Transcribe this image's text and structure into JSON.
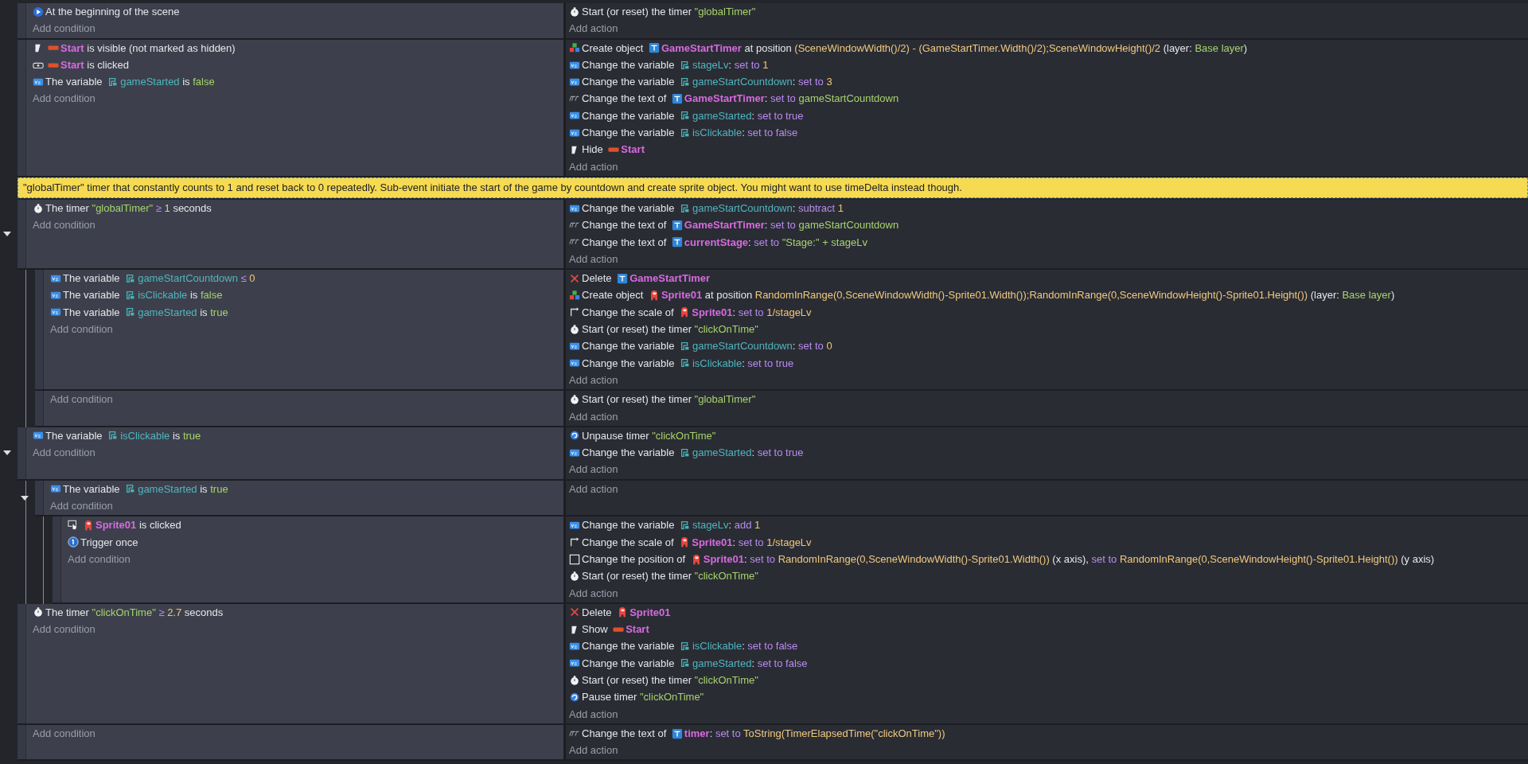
{
  "events": [
    {
      "kind": "event",
      "conditions": [
        {
          "kind": "scene-start",
          "parts": [
            {
              "kind": "plain",
              "text": "At the beginning of the scene"
            }
          ]
        }
      ],
      "add_condition": "Add condition",
      "actions": [
        {
          "kind": "timer",
          "parts": [
            {
              "kind": "plain",
              "text": "Start (or reset) the timer "
            },
            {
              "kind": "str",
              "text": "\"globalTimer\""
            }
          ]
        }
      ],
      "add_action": "Add action"
    },
    {
      "kind": "event",
      "conditions": [
        {
          "kind": "visible",
          "parts": [
            {
              "kind": "obj-button",
              "text": "Start"
            },
            {
              "kind": "plain",
              "text": " is visible (not marked as hidden)"
            }
          ]
        },
        {
          "kind": "click",
          "parts": [
            {
              "kind": "obj-button",
              "text": "Start"
            },
            {
              "kind": "plain",
              "text": " is clicked"
            }
          ]
        },
        {
          "kind": "var",
          "parts": [
            {
              "kind": "plain",
              "text": "The variable "
            },
            {
              "kind": "var",
              "text": "gameStarted"
            },
            {
              "kind": "plain",
              "text": " is "
            },
            {
              "kind": "val",
              "text": "false"
            }
          ]
        }
      ],
      "add_condition": "Add condition",
      "actions": [
        {
          "kind": "create",
          "parts": [
            {
              "kind": "plain",
              "text": "Create object "
            },
            {
              "kind": "obj-text",
              "text": "GameStartTimer"
            },
            {
              "kind": "plain",
              "text": " at position "
            },
            {
              "kind": "expr",
              "text": "(SceneWindowWidth()/2) - (GameStartTimer.Width()/2);SceneWindowHeight()/2"
            },
            {
              "kind": "plain",
              "text": " (layer: "
            },
            {
              "kind": "val",
              "text": "Base layer"
            },
            {
              "kind": "plain",
              "text": ")"
            }
          ]
        },
        {
          "kind": "var",
          "parts": [
            {
              "kind": "plain",
              "text": "Change the variable "
            },
            {
              "kind": "var",
              "text": "stageLv"
            },
            {
              "kind": "plain",
              "text": ": "
            },
            {
              "kind": "op",
              "text": "set to "
            },
            {
              "kind": "num",
              "text": "1"
            }
          ]
        },
        {
          "kind": "var",
          "parts": [
            {
              "kind": "plain",
              "text": "Change the variable "
            },
            {
              "kind": "var",
              "text": "gameStartCountdown"
            },
            {
              "kind": "plain",
              "text": ": "
            },
            {
              "kind": "op",
              "text": "set to "
            },
            {
              "kind": "num",
              "text": "3"
            }
          ]
        },
        {
          "kind": "text",
          "parts": [
            {
              "kind": "plain",
              "text": "Change the text of "
            },
            {
              "kind": "obj-text",
              "text": "GameStartTimer"
            },
            {
              "kind": "plain",
              "text": ": "
            },
            {
              "kind": "op",
              "text": "set to "
            },
            {
              "kind": "val",
              "text": "gameStartCountdown"
            }
          ]
        },
        {
          "kind": "var",
          "parts": [
            {
              "kind": "plain",
              "text": "Change the variable "
            },
            {
              "kind": "var",
              "text": "gameStarted"
            },
            {
              "kind": "plain",
              "text": ": "
            },
            {
              "kind": "op",
              "text": "set to true"
            }
          ]
        },
        {
          "kind": "var",
          "parts": [
            {
              "kind": "plain",
              "text": "Change the variable "
            },
            {
              "kind": "var",
              "text": "isClickable"
            },
            {
              "kind": "plain",
              "text": ": "
            },
            {
              "kind": "op",
              "text": "set to false"
            }
          ]
        },
        {
          "kind": "visible",
          "parts": [
            {
              "kind": "plain",
              "text": "Hide "
            },
            {
              "kind": "obj-button",
              "text": "Start"
            }
          ]
        }
      ],
      "add_action": "Add action"
    },
    {
      "kind": "comment",
      "text": "\"globalTimer\" timer that constantly counts to 1 and reset back to 0 repeatedly. Sub-event initiate the start of the game by countdown and create sprite object. You might want to use timeDelta instead though."
    },
    {
      "kind": "event",
      "expanded": true,
      "conditions": [
        {
          "kind": "timer",
          "parts": [
            {
              "kind": "plain",
              "text": "The timer "
            },
            {
              "kind": "str",
              "text": "\"globalTimer\""
            },
            {
              "kind": "op",
              "text": " ≥ "
            },
            {
              "kind": "num",
              "text": "1"
            },
            {
              "kind": "plain",
              "text": " seconds"
            }
          ]
        }
      ],
      "add_condition": "Add condition",
      "actions": [
        {
          "kind": "var",
          "parts": [
            {
              "kind": "plain",
              "text": "Change the variable "
            },
            {
              "kind": "var",
              "text": "gameStartCountdown"
            },
            {
              "kind": "plain",
              "text": ": "
            },
            {
              "kind": "op",
              "text": "subtract "
            },
            {
              "kind": "num",
              "text": "1"
            }
          ]
        },
        {
          "kind": "text",
          "parts": [
            {
              "kind": "plain",
              "text": "Change the text of "
            },
            {
              "kind": "obj-text",
              "text": "GameStartTimer"
            },
            {
              "kind": "plain",
              "text": ": "
            },
            {
              "kind": "op",
              "text": "set to "
            },
            {
              "kind": "val",
              "text": "gameStartCountdown"
            }
          ]
        },
        {
          "kind": "text",
          "parts": [
            {
              "kind": "plain",
              "text": "Change the text of "
            },
            {
              "kind": "obj-text",
              "text": "currentStage"
            },
            {
              "kind": "plain",
              "text": ": "
            },
            {
              "kind": "op",
              "text": "set to "
            },
            {
              "kind": "val",
              "text": "\"Stage:\" + stageLv"
            }
          ]
        }
      ],
      "add_action": "Add action",
      "children": [
        {
          "kind": "event",
          "conditions": [
            {
              "kind": "var",
              "parts": [
                {
                  "kind": "plain",
                  "text": "The variable "
                },
                {
                  "kind": "var",
                  "text": "gameStartCountdown"
                },
                {
                  "kind": "op",
                  "text": " ≤ "
                },
                {
                  "kind": "num",
                  "text": "0"
                }
              ]
            },
            {
              "kind": "var",
              "parts": [
                {
                  "kind": "plain",
                  "text": "The variable "
                },
                {
                  "kind": "var",
                  "text": "isClickable"
                },
                {
                  "kind": "plain",
                  "text": " is "
                },
                {
                  "kind": "val",
                  "text": "false"
                }
              ]
            },
            {
              "kind": "var",
              "parts": [
                {
                  "kind": "plain",
                  "text": "The variable "
                },
                {
                  "kind": "var",
                  "text": "gameStarted"
                },
                {
                  "kind": "plain",
                  "text": " is "
                },
                {
                  "kind": "val",
                  "text": "true"
                }
              ]
            }
          ],
          "add_condition": "Add condition",
          "actions": [
            {
              "kind": "delete",
              "parts": [
                {
                  "kind": "plain",
                  "text": "Delete "
                },
                {
                  "kind": "obj-text",
                  "text": "GameStartTimer"
                }
              ]
            },
            {
              "kind": "create",
              "parts": [
                {
                  "kind": "plain",
                  "text": "Create object "
                },
                {
                  "kind": "obj-sprite",
                  "text": "Sprite01"
                },
                {
                  "kind": "plain",
                  "text": " at position "
                },
                {
                  "kind": "expr",
                  "text": "RandomInRange(0,SceneWindowWidth()-Sprite01.Width());RandomInRange(0,SceneWindowHeight()-Sprite01.Height())"
                },
                {
                  "kind": "plain",
                  "text": " (layer: "
                },
                {
                  "kind": "val",
                  "text": "Base layer"
                },
                {
                  "kind": "plain",
                  "text": ")"
                }
              ]
            },
            {
              "kind": "scale",
              "parts": [
                {
                  "kind": "plain",
                  "text": "Change the scale of "
                },
                {
                  "kind": "obj-sprite",
                  "text": "Sprite01"
                },
                {
                  "kind": "plain",
                  "text": ": "
                },
                {
                  "kind": "op",
                  "text": "set to "
                },
                {
                  "kind": "num",
                  "text": "1/stageLv"
                }
              ]
            },
            {
              "kind": "timer",
              "parts": [
                {
                  "kind": "plain",
                  "text": "Start (or reset) the timer "
                },
                {
                  "kind": "str",
                  "text": "\"clickOnTime\""
                }
              ]
            },
            {
              "kind": "var",
              "parts": [
                {
                  "kind": "plain",
                  "text": "Change the variable "
                },
                {
                  "kind": "var",
                  "text": "gameStartCountdown"
                },
                {
                  "kind": "plain",
                  "text": ": "
                },
                {
                  "kind": "op",
                  "text": "set to "
                },
                {
                  "kind": "num",
                  "text": "0"
                }
              ]
            },
            {
              "kind": "var",
              "parts": [
                {
                  "kind": "plain",
                  "text": "Change the variable "
                },
                {
                  "kind": "var",
                  "text": "isClickable"
                },
                {
                  "kind": "plain",
                  "text": ": "
                },
                {
                  "kind": "op",
                  "text": "set to true"
                }
              ]
            }
          ],
          "add_action": "Add action"
        },
        {
          "kind": "event",
          "add_condition": "Add condition",
          "actions": [
            {
              "kind": "timer",
              "parts": [
                {
                  "kind": "plain",
                  "text": "Start (or reset) the timer "
                },
                {
                  "kind": "str",
                  "text": "\"globalTimer\""
                }
              ]
            }
          ],
          "add_action": "Add action"
        }
      ]
    },
    {
      "kind": "event",
      "expanded": true,
      "conditions": [
        {
          "kind": "var",
          "parts": [
            {
              "kind": "plain",
              "text": "The variable "
            },
            {
              "kind": "var",
              "text": "isClickable"
            },
            {
              "kind": "plain",
              "text": " is "
            },
            {
              "kind": "val",
              "text": "true"
            }
          ]
        }
      ],
      "add_condition": "Add condition",
      "actions": [
        {
          "kind": "unpause",
          "parts": [
            {
              "kind": "plain",
              "text": "Unpause timer "
            },
            {
              "kind": "str",
              "text": "\"clickOnTime\""
            }
          ]
        },
        {
          "kind": "var",
          "parts": [
            {
              "kind": "plain",
              "text": "Change the variable "
            },
            {
              "kind": "var",
              "text": "gameStarted"
            },
            {
              "kind": "plain",
              "text": ": "
            },
            {
              "kind": "op",
              "text": "set to true"
            }
          ]
        }
      ],
      "add_action": "Add action",
      "children": [
        {
          "kind": "event",
          "expanded": true,
          "conditions": [
            {
              "kind": "var",
              "parts": [
                {
                  "kind": "plain",
                  "text": "The variable "
                },
                {
                  "kind": "var",
                  "text": "gameStarted"
                },
                {
                  "kind": "plain",
                  "text": " is "
                },
                {
                  "kind": "val",
                  "text": "true"
                }
              ]
            }
          ],
          "add_condition": "Add condition",
          "add_action": "Add action",
          "children": [
            {
              "kind": "event",
              "conditions": [
                {
                  "kind": "touch",
                  "parts": [
                    {
                      "kind": "obj-sprite",
                      "text": "Sprite01"
                    },
                    {
                      "kind": "plain",
                      "text": " is clicked"
                    }
                  ]
                },
                {
                  "kind": "trigger",
                  "parts": [
                    {
                      "kind": "plain",
                      "text": "Trigger once"
                    }
                  ]
                }
              ],
              "add_condition": "Add condition",
              "actions": [
                {
                  "kind": "var",
                  "parts": [
                    {
                      "kind": "plain",
                      "text": "Change the variable "
                    },
                    {
                      "kind": "var",
                      "text": "stageLv"
                    },
                    {
                      "kind": "plain",
                      "text": ": "
                    },
                    {
                      "kind": "op",
                      "text": "add "
                    },
                    {
                      "kind": "num",
                      "text": "1"
                    }
                  ]
                },
                {
                  "kind": "scale",
                  "parts": [
                    {
                      "kind": "plain",
                      "text": "Change the scale of "
                    },
                    {
                      "kind": "obj-sprite",
                      "text": "Sprite01"
                    },
                    {
                      "kind": "plain",
                      "text": ": "
                    },
                    {
                      "kind": "op",
                      "text": "set to "
                    },
                    {
                      "kind": "num",
                      "text": "1/stageLv"
                    }
                  ]
                },
                {
                  "kind": "position",
                  "parts": [
                    {
                      "kind": "plain",
                      "text": "Change the position of "
                    },
                    {
                      "kind": "obj-sprite",
                      "text": "Sprite01"
                    },
                    {
                      "kind": "plain",
                      "text": ": "
                    },
                    {
                      "kind": "op",
                      "text": "set to "
                    },
                    {
                      "kind": "expr",
                      "text": "RandomInRange(0,SceneWindowWidth()-Sprite01.Width())"
                    },
                    {
                      "kind": "plain",
                      "text": " (x axis), "
                    },
                    {
                      "kind": "op",
                      "text": "set to "
                    },
                    {
                      "kind": "expr",
                      "text": "RandomInRange(0,SceneWindowHeight()-Sprite01.Height())"
                    },
                    {
                      "kind": "plain",
                      "text": " (y axis)"
                    }
                  ]
                },
                {
                  "kind": "timer",
                  "parts": [
                    {
                      "kind": "plain",
                      "text": "Start (or reset) the timer "
                    },
                    {
                      "kind": "str",
                      "text": "\"clickOnTime\""
                    }
                  ]
                }
              ],
              "add_action": "Add action"
            }
          ]
        }
      ]
    },
    {
      "kind": "event",
      "conditions": [
        {
          "kind": "timer",
          "parts": [
            {
              "kind": "plain",
              "text": "The timer "
            },
            {
              "kind": "str",
              "text": "\"clickOnTime\""
            },
            {
              "kind": "op",
              "text": " ≥ "
            },
            {
              "kind": "num",
              "text": "2.7"
            },
            {
              "kind": "plain",
              "text": " seconds"
            }
          ]
        }
      ],
      "add_condition": "Add condition",
      "actions": [
        {
          "kind": "delete",
          "parts": [
            {
              "kind": "plain",
              "text": "Delete "
            },
            {
              "kind": "obj-sprite",
              "text": "Sprite01"
            }
          ]
        },
        {
          "kind": "visible",
          "parts": [
            {
              "kind": "plain",
              "text": "Show "
            },
            {
              "kind": "obj-button",
              "text": "Start"
            }
          ]
        },
        {
          "kind": "var",
          "parts": [
            {
              "kind": "plain",
              "text": "Change the variable "
            },
            {
              "kind": "var",
              "text": "isClickable"
            },
            {
              "kind": "plain",
              "text": ": "
            },
            {
              "kind": "op",
              "text": "set to false"
            }
          ]
        },
        {
          "kind": "var",
          "parts": [
            {
              "kind": "plain",
              "text": "Change the variable "
            },
            {
              "kind": "var",
              "text": "gameStarted"
            },
            {
              "kind": "plain",
              "text": ": "
            },
            {
              "kind": "op",
              "text": "set to false"
            }
          ]
        },
        {
          "kind": "timer",
          "parts": [
            {
              "kind": "plain",
              "text": "Start (or reset) the timer "
            },
            {
              "kind": "str",
              "text": "\"clickOnTime\""
            }
          ]
        },
        {
          "kind": "pause",
          "parts": [
            {
              "kind": "plain",
              "text": "Pause timer "
            },
            {
              "kind": "str",
              "text": "\"clickOnTime\""
            }
          ]
        }
      ],
      "add_action": "Add action"
    },
    {
      "kind": "event",
      "add_condition": "Add condition",
      "actions": [
        {
          "kind": "text",
          "parts": [
            {
              "kind": "plain",
              "text": "Change the text of "
            },
            {
              "kind": "obj-text",
              "text": "timer"
            },
            {
              "kind": "plain",
              "text": ": "
            },
            {
              "kind": "op",
              "text": "set to "
            },
            {
              "kind": "expr",
              "text": "ToString(TimerElapsedTime(\"clickOnTime\"))"
            }
          ]
        }
      ],
      "add_action": "Add action"
    }
  ]
}
